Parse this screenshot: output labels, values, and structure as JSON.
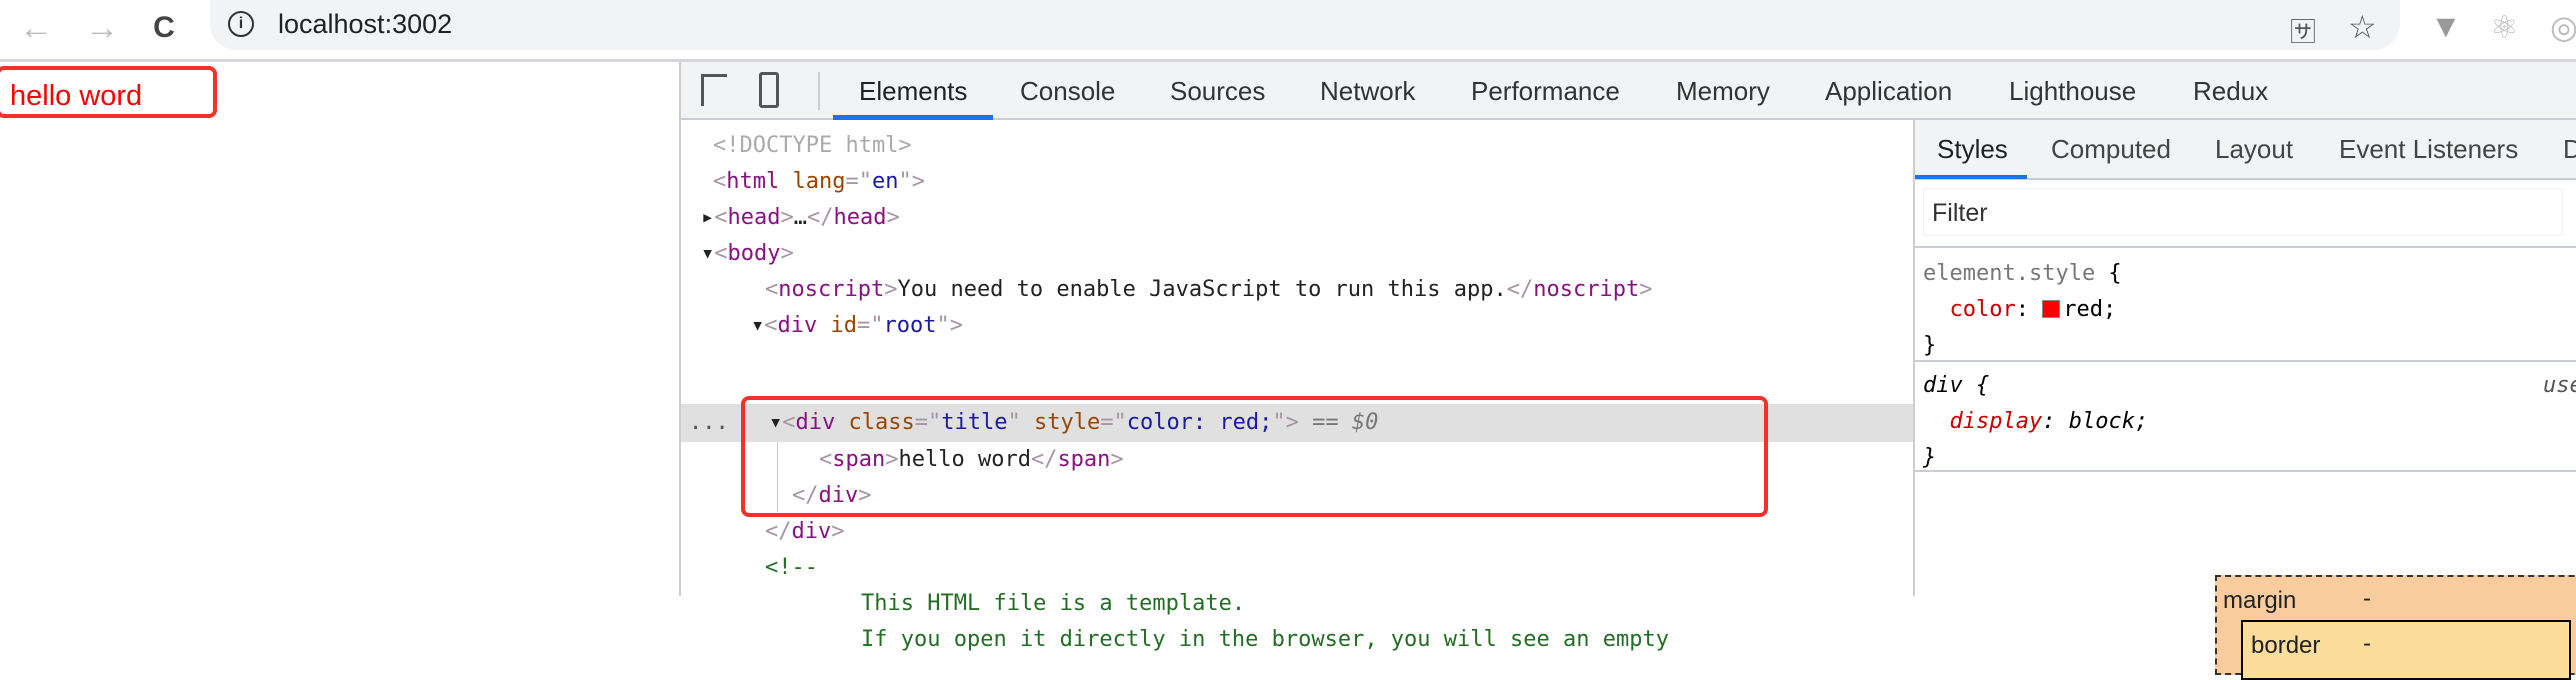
{
  "browser": {
    "url": "localhost:3002",
    "back": "←",
    "forward": "→",
    "reload": "C",
    "icons": [
      "info-icon",
      "translate-icon",
      "star-icon",
      "vue-extension-icon",
      "react-extension-icon"
    ]
  },
  "page": {
    "text": "hello word",
    "text_color": "#ff0000",
    "highlight_color": "#f5302a"
  },
  "devtools": {
    "tabs": [
      "Elements",
      "Console",
      "Sources",
      "Network",
      "Performance",
      "Memory",
      "Application",
      "Lighthouse",
      "Redux"
    ],
    "active_tab": "Elements",
    "dom": {
      "doctype": "<!DOCTYPE html>",
      "html_tag": "html",
      "lang_attr": "lang",
      "lang_val": "en",
      "head": "head",
      "ellipsis": "…",
      "body": "body",
      "noscript": "noscript",
      "noscript_text": "You need to enable JavaScript to run this app.",
      "div": "div",
      "id_attr": "id",
      "id_val": "root",
      "class_attr": "class",
      "class_val": "title",
      "style_attr": "style",
      "style_val": "color: red;",
      "selected_marker": "== $0",
      "dots": "...",
      "span": "span",
      "span_text": "hello word",
      "comment_open": "<!--",
      "comment_line1": "This HTML file is a template.",
      "comment_line2": "If you open it directly in the browser, you will see an empty"
    },
    "styles": {
      "tabs": [
        "Styles",
        "Computed",
        "Layout",
        "Event Listeners",
        "D"
      ],
      "active_tab": "Styles",
      "filter_placeholder": "Filter",
      "rule1": {
        "selector": "element.style",
        "prop": "color",
        "value": "red",
        "swatch": "#ff0000"
      },
      "rule2": {
        "selector": "div",
        "prop": "display",
        "value": "block",
        "origin": "use"
      },
      "box_model": {
        "margin_label": "margin",
        "margin_val": "-",
        "border_label": "border",
        "border_val": "-"
      }
    }
  }
}
